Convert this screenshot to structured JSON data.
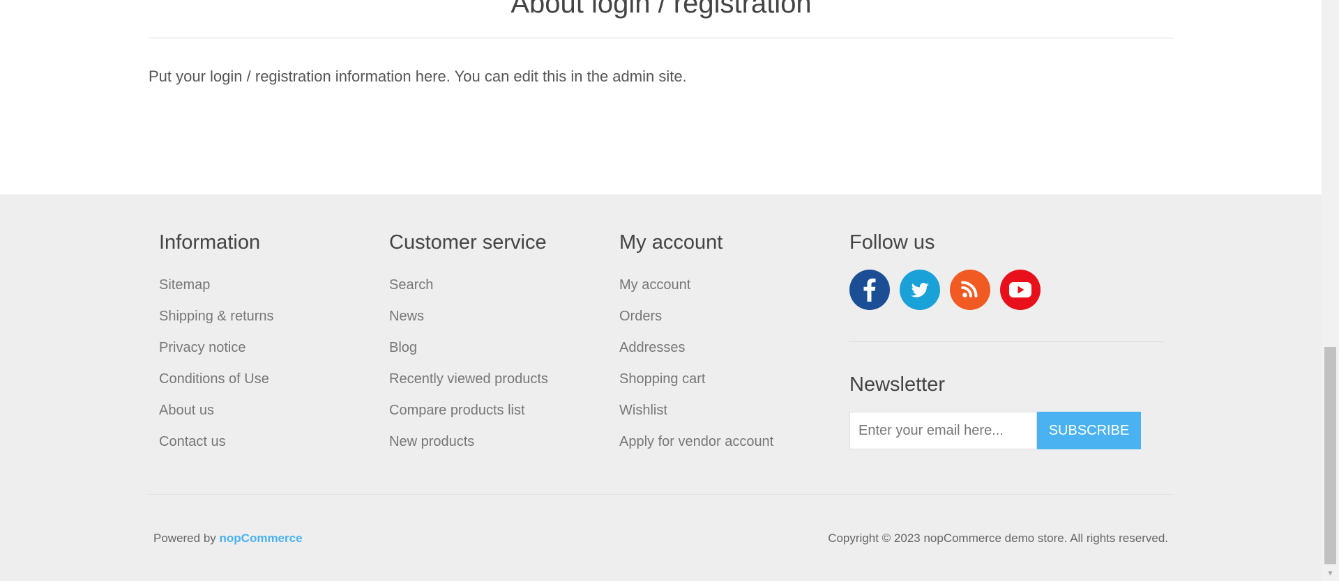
{
  "topic": {
    "title": "About login / registration",
    "body": "Put your login / registration information here. You can edit this in the admin site."
  },
  "footer": {
    "information": {
      "title": "Information",
      "links": [
        "Sitemap",
        "Shipping & returns",
        "Privacy notice",
        "Conditions of Use",
        "About us",
        "Contact us"
      ]
    },
    "customer_service": {
      "title": "Customer service",
      "links": [
        "Search",
        "News",
        "Blog",
        "Recently viewed products",
        "Compare products list",
        "New products"
      ]
    },
    "my_account": {
      "title": "My account",
      "links": [
        "My account",
        "Orders",
        "Addresses",
        "Shopping cart",
        "Wishlist",
        "Apply for vendor account"
      ]
    },
    "follow_us": {
      "title": "Follow us",
      "icons": [
        "facebook-icon",
        "twitter-icon",
        "rss-icon",
        "youtube-icon"
      ]
    },
    "newsletter": {
      "title": "Newsletter",
      "placeholder": "Enter your email here...",
      "subscribe_label": "SUBSCRIBE"
    },
    "powered_by_prefix": "Powered by",
    "powered_by_link": "nopCommerce",
    "copyright": "Copyright © 2023 nopCommerce demo store. All rights reserved."
  },
  "colors": {
    "accent": "#4ab2f1",
    "footer_bg": "#eeeeee",
    "facebook": "#1b4e94",
    "twitter": "#1aa1d8",
    "rss": "#f15a22",
    "youtube": "#e8101a"
  }
}
